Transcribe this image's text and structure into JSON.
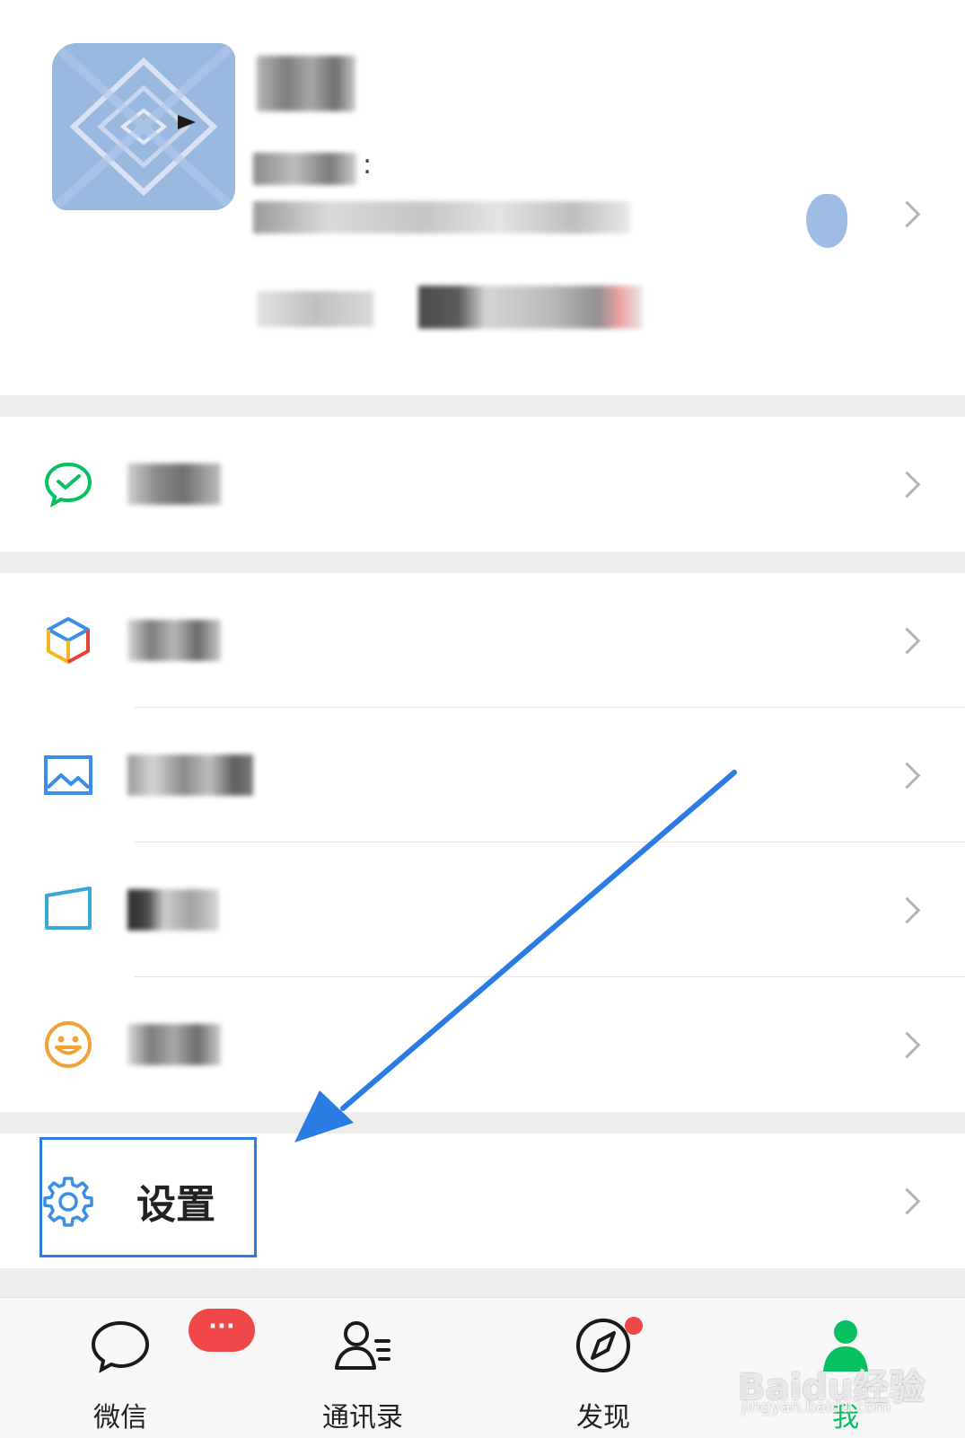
{
  "menu": {
    "settings_label": "设置"
  },
  "tabbar": {
    "chats_label": "微信",
    "chats_badge": "···",
    "contacts_label": "通讯录",
    "discover_label": "发现",
    "me_label": "我"
  },
  "watermark": {
    "brand": "Baidu经验",
    "url": "jingyan.baidu.com"
  },
  "colors": {
    "accent": "#07c160",
    "badge": "#f04848",
    "highlight": "#2e7cde",
    "arrow": "#2a7be4"
  }
}
